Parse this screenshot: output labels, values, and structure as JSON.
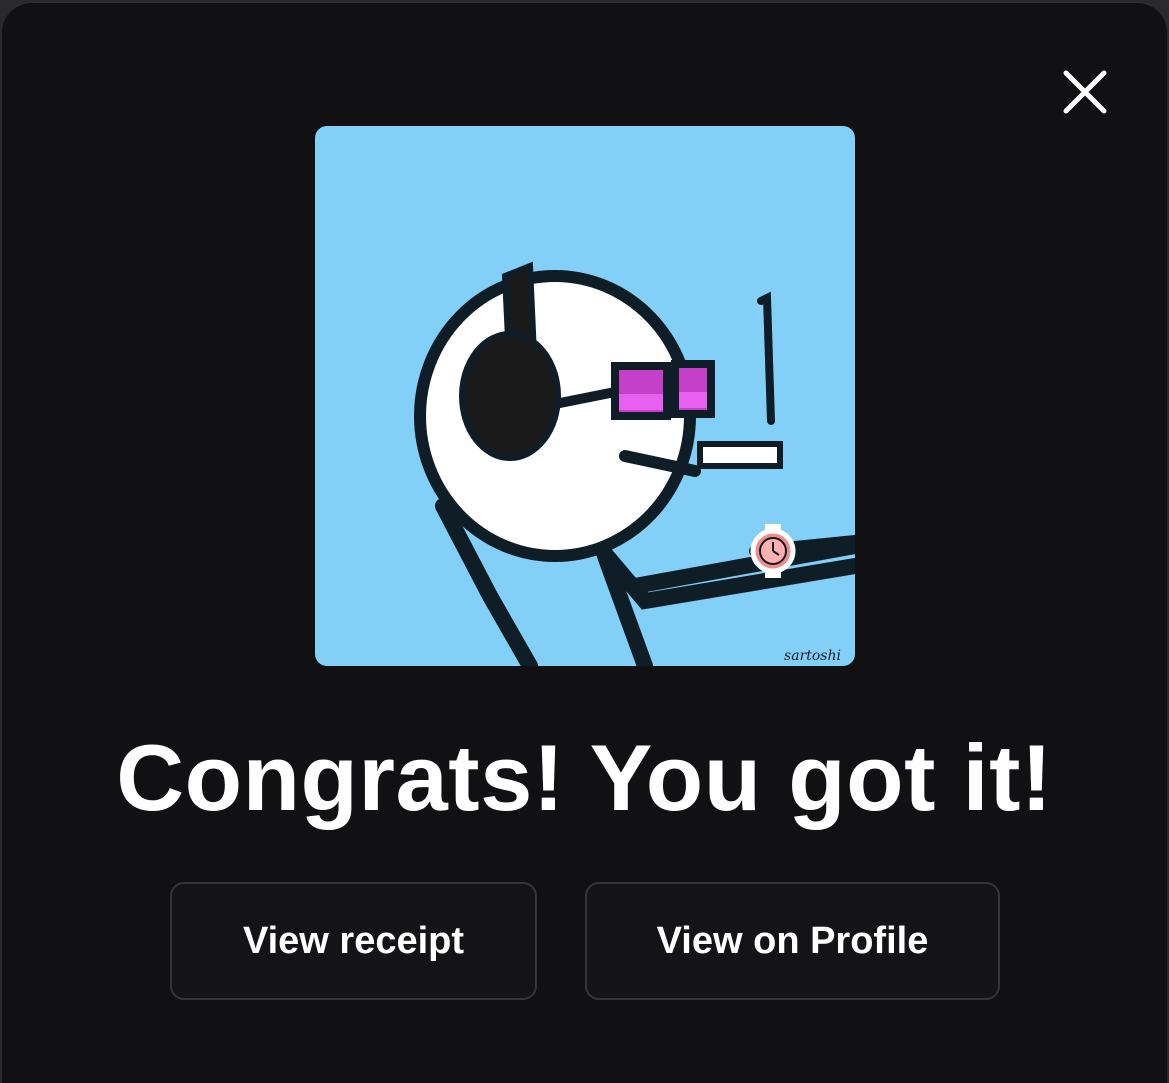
{
  "dialog": {
    "close_icon": "close-icon",
    "artwork": {
      "signature": "sartoshi",
      "background_color": "#82d0f8"
    },
    "headline": "Congrats! You got it!",
    "buttons": {
      "view_receipt": "View receipt",
      "view_on_profile": "View on Profile"
    }
  }
}
